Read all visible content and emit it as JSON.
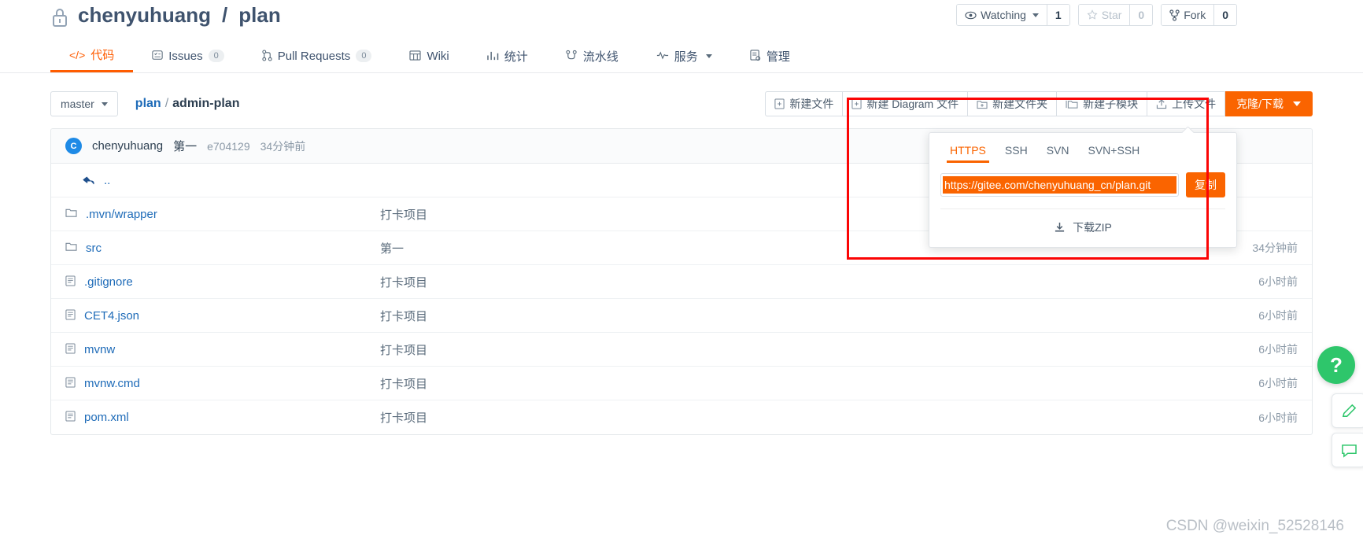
{
  "header": {
    "lock_icon": "lock-icon",
    "owner": "chenyuhuang",
    "separator": "/",
    "repo": "plan",
    "actions": {
      "watching_icon": "eye-icon",
      "watching_label": "Watching",
      "watching_count": "1",
      "star_icon": "star-icon",
      "star_label": "Star",
      "star_count": "0",
      "fork_icon": "fork-icon",
      "fork_label": "Fork",
      "fork_count": "0"
    }
  },
  "nav": {
    "tabs": [
      {
        "icon": "code-icon",
        "label": "代码",
        "badge": "",
        "active": true
      },
      {
        "icon": "issues-icon",
        "label": "Issues",
        "badge": "0",
        "active": false
      },
      {
        "icon": "pull-request-icon",
        "label": "Pull Requests",
        "badge": "0",
        "active": false
      },
      {
        "icon": "wiki-icon",
        "label": "Wiki",
        "badge": "",
        "active": false
      },
      {
        "icon": "chart-icon",
        "label": "统计",
        "badge": "",
        "active": false
      },
      {
        "icon": "pipeline-icon",
        "label": "流水线",
        "badge": "",
        "active": false
      },
      {
        "icon": "service-icon",
        "label": "服务",
        "badge": "",
        "active": false,
        "caret": true
      },
      {
        "icon": "manage-icon",
        "label": "管理",
        "badge": "",
        "active": false
      }
    ]
  },
  "toolbar": {
    "branch": "master",
    "breadcrumb": {
      "root": "plan",
      "sep": "/",
      "current": "admin-plan"
    },
    "buttons": [
      {
        "icon": "new-file-icon",
        "label": "新建文件"
      },
      {
        "icon": "new-file-icon",
        "label": "新建 Diagram 文件"
      },
      {
        "icon": "new-folder-icon",
        "label": "新建文件夹"
      },
      {
        "icon": "new-submodule-icon",
        "label": "新建子模块"
      },
      {
        "icon": "upload-icon",
        "label": "上传文件"
      }
    ],
    "clone_button": {
      "label": "克隆/下载",
      "caret_icon": "chevron-down-icon"
    }
  },
  "clone_panel": {
    "tabs": [
      "HTTPS",
      "SSH",
      "SVN",
      "SVN+SSH"
    ],
    "active_tab": "HTTPS",
    "url": "https://gitee.com/chenyuhuang_cn/plan.git",
    "copy_label": "复制",
    "zip_icon": "download-icon",
    "zip_label": "下载ZIP",
    "accent_color": "#fa6400"
  },
  "commit_bar": {
    "avatar_initial": "C",
    "author": "chenyuhuang",
    "message": "第一",
    "sha": "e704129",
    "time": "34分钟前"
  },
  "file_table": {
    "up_row": {
      "icon": "arrow-up-icon",
      "label": "..",
      "message": "",
      "time": ""
    },
    "rows": [
      {
        "icon": "folder-icon",
        "type": "folder",
        "name": ".mvn/wrapper",
        "message": "打卡项目",
        "time": ""
      },
      {
        "icon": "folder-icon",
        "type": "folder",
        "name": "src",
        "message": "第一",
        "time": "34分钟前"
      },
      {
        "icon": "file-icon",
        "type": "file",
        "name": ".gitignore",
        "message": "打卡项目",
        "time": "6小时前"
      },
      {
        "icon": "file-icon",
        "type": "file",
        "name": "CET4.json",
        "message": "打卡项目",
        "time": "6小时前"
      },
      {
        "icon": "file-icon",
        "type": "file",
        "name": "mvnw",
        "message": "打卡项目",
        "time": "6小时前"
      },
      {
        "icon": "file-icon",
        "type": "file",
        "name": "mvnw.cmd",
        "message": "打卡项目",
        "time": "6小时前"
      },
      {
        "icon": "file-icon",
        "type": "file",
        "name": "pom.xml",
        "message": "打卡项目",
        "time": "6小时前"
      }
    ]
  },
  "floating": {
    "help_icon": "question-mark-icon",
    "edit_icon": "edit-icon",
    "chat_icon": "chat-icon"
  },
  "annotation": {
    "box_color": "#fb0505"
  },
  "watermark": "CSDN @weixin_52528146"
}
